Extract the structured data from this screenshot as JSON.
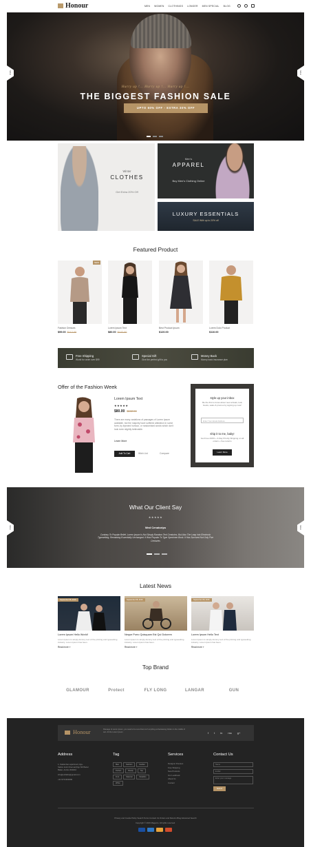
{
  "header": {
    "logo": "Honour",
    "nav": [
      "MEN",
      "WOMEN",
      "CLOTHINGS",
      "LONGER",
      "MEN SPECIAL",
      "BLOG"
    ],
    "icons": [
      "search-icon",
      "user-icon",
      "bag-icon"
    ]
  },
  "hero": {
    "subtitle": "Hurry up !...   Hurry up !...   Hurry up !...",
    "title": "THE BIGGEST FASHION SALE",
    "cta": "UPTO 60% OFF - EXTRA 30% OFF",
    "slides": 3,
    "active_slide": 1
  },
  "side_tabs": {
    "left": "SALE",
    "right": "SALE"
  },
  "banners": {
    "winter": {
      "subtitle": "Winter",
      "title": "CLOTHES",
      "offer": "Get Extra 20% Off"
    },
    "apparel": {
      "subtitle": "Men's",
      "title": "APPAREL",
      "offer": "Buy Men's Clothing Online"
    },
    "luxury": {
      "title": "LUXURY ESSENTIALS",
      "offer": "SALE With up to 20% off"
    }
  },
  "featured": {
    "title": "Featured Product",
    "products": [
      {
        "name": "Fashion Dresses",
        "price": "$99.00",
        "old": "$112.00",
        "badge": "NEW"
      },
      {
        "name": "Lorem Ipsum Text",
        "price": "$80.00",
        "old": "$102.00",
        "badge": ""
      },
      {
        "name": "Best Product Ipsum",
        "price": "$120.00",
        "old": "",
        "badge": ""
      },
      {
        "name": "Lorem Dolo Product",
        "price": "$110.00",
        "old": "",
        "badge": ""
      }
    ]
  },
  "services": [
    {
      "icon": "truck-icon",
      "title": "Free Shipping",
      "sub": "World for order over $99"
    },
    {
      "icon": "gift-icon",
      "title": "Special Gift",
      "sub": "Give the perfect gift to you"
    },
    {
      "icon": "money-icon",
      "title": "Money Back",
      "sub": "Money back insurance plan"
    }
  ],
  "offer": {
    "title": "Offer of the Fashion Week",
    "product_name": "Lorem Ipsum Text",
    "stars": "★★★★★",
    "price": "$80.00",
    "old_price": "$102.00",
    "description": "There are many variations of passages of Lorem Ipsum available, but the majority have suffered alteration in some form, by injected humour, or randomised words which don't look even slightly believable.",
    "learn_more": "Learn More",
    "add_to_cart": "Add To Cart",
    "wishlist": "Wish List",
    "compare": "Compare"
  },
  "newsletter": {
    "title1": "style up your inbox",
    "desc1": "Be the first to know about new arrivals, look books, sales & promos by signing up now!",
    "placeholder": "Enter Your Email Address",
    "title2": "ship it to me, baby!",
    "desc2": "Get Free 200% + 2-Day Priority Shipping on all orders + free returns",
    "button": "Learn More"
  },
  "testimonial": {
    "title": "What Our Client Say",
    "stars": "★★★★★",
    "name": "Wed Cenatorips",
    "quote": "Contrary To Popular Belief, Lorem Ipsum Is Not Simply Random Text Centuries, But Also The Leap Into Electronic Typesetting, Remaining Essentially Unchanged. It Was Popular To Type Specimen Book. It Has Survived Not Only Five Centuries",
    "slides": 3,
    "active_slide": 1
  },
  "news": {
    "title": "Latest News",
    "articles": [
      {
        "date": "September 08, 2016",
        "title": "Lorem Ipsum Hello World!",
        "text": "Lorem Ipsum is simply dummy text of the printing and typesetting industry. Lorem Ipsum has been.",
        "more": "Read more »"
      },
      {
        "date": "September 08, 2016",
        "title": "Neque Porro Quisquam Est Qui Dolorem",
        "text": "Lorem Ipsum is simply dummy text of the printing and typesetting industry. Lorem Ipsum has been.",
        "more": "Read more »"
      },
      {
        "date": "September 08, 2016",
        "title": "Lorem Ipsum Hello Text",
        "text": "Lorem Ipsum is simply dummy text of the printing and typesetting industry. Lorem Ipsum has been.",
        "more": "Read more »"
      }
    ]
  },
  "brands": {
    "title": "Top Brand",
    "items": [
      "GLAMOUR",
      "Protect",
      "FLY LONG",
      "LANGAR",
      "GUN"
    ]
  },
  "footer": {
    "logo": "Honour",
    "desc": "Passage of Lorem Ipsum, you need to be sure there isn't anything embarrassing hidden in the middle of text. All the Lorem Ipsum",
    "social": [
      "f",
      "t",
      "in",
      "rss",
      "g+"
    ],
    "address_title": "Address",
    "address": [
      "1, Kadamban apartment,Ugs-",
      "Satlon dock Chennai(Opp SD Bazar",
      "Balan, Ambur-600210",
      "info@softlabs@gmail.com",
      "+91 9741930296"
    ],
    "tag_title": "Tag",
    "tags": [
      "Man",
      "Fashion",
      "Garden",
      "Perfect",
      "Ready",
      "Top",
      "Fruit",
      "Material",
      "Metallics",
      "White"
    ],
    "services_title": "Services",
    "services": [
      "Designer Dresses",
      "Free Shipping",
      "New Products",
      "Our Lookbook",
      "About Us",
      "Contact"
    ],
    "contact_title": "Contact Us",
    "contact_name": "Name",
    "contact_email": "E-Mail",
    "contact_message": "Enter your message",
    "contact_button": "Submit",
    "bottom_links": "Privacy and Cookie Policy    Search Terms    Contact Us    Orders and Returns    Blog    Advanced Search",
    "copyright": "Copyright © 2016 Magento. All rights reserved.",
    "payments": [
      "visa-icon",
      "paypal-icon",
      "mastercard-icon",
      "discover-icon"
    ]
  }
}
